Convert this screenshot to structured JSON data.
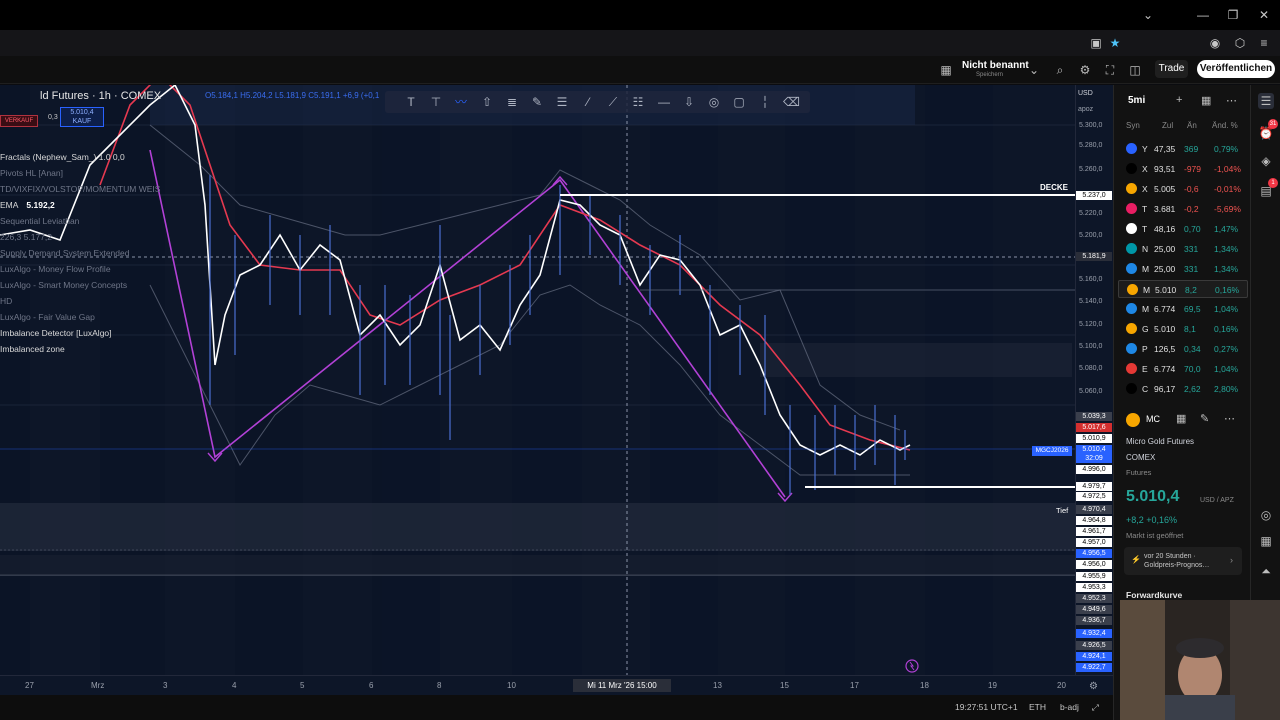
{
  "window": {
    "controls": [
      "⌄",
      "—",
      "❐",
      "✕"
    ]
  },
  "header": {
    "layout_name": "Nicht benannt",
    "layout_sub": "Speichern",
    "trade_label": "Trade",
    "publish_label": "Veröffentlichen"
  },
  "chart": {
    "symbol_title": "ld Futures · 1h · COMEX",
    "ohlc": "O5.184,1 H5.204,2 L5.181,9 C5.191,1 +6,9 (+0,1",
    "sell": {
      "label": "VERKAUF"
    },
    "buy": {
      "price": "5.010,4",
      "label": "KAUF"
    },
    "spread": "0,3",
    "indicators": [
      {
        "name": "Fractals (Nephew_Sam_) 1.0 0,0",
        "value": "",
        "dim": false
      },
      {
        "name": "Pivots HL [Anan]",
        "value": "",
        "dim": true
      },
      {
        "name": "TD/VIXFIX/VOLSTOP/MOMENTUM WEIS",
        "value": "",
        "dim": true
      },
      {
        "name": "EMA",
        "value": "5.192,2",
        "dim": false
      },
      {
        "name": "Sequential Leviathan",
        "value": "",
        "dim": true
      },
      {
        "name": "226,3 5.177,2",
        "value": "",
        "dim": true
      },
      {
        "name": "Supply Demand System Extended",
        "value": "",
        "dim": true
      },
      {
        "name": "LuxAlgo - Money Flow Profile",
        "value": "",
        "dim": true
      },
      {
        "name": "LuxAlgo - Smart Money Concepts",
        "value": "",
        "dim": true
      },
      {
        "name": "HD",
        "value": "",
        "dim": true
      },
      {
        "name": "LuxAlgo - Fair Value Gap",
        "value": "",
        "dim": true
      },
      {
        "name": "Imbalance Detector [LuxAlgo]",
        "value": "",
        "dim": false
      },
      {
        "name": "Imbalanced zone",
        "value": "",
        "dim": false
      }
    ],
    "decke_label": "DECKE",
    "tief_label": "Tief",
    "contract_tag": "MGCJ2026"
  },
  "price_axis": {
    "currency": "USD",
    "unit": "apoz",
    "labels": [
      "5.300,0",
      "5.280,0",
      "5.260,0",
      "5.240,0",
      "5.220,0",
      "5.200,0",
      "5.180,0",
      "5.160,0",
      "5.140,0",
      "5.120,0",
      "5.100,0",
      "5.080,0",
      "5.060,0",
      "5.040,0"
    ],
    "tags": [
      {
        "text": "5.237,0",
        "color": "#ffffff",
        "fg": "#000000"
      },
      {
        "text": "5.181,9",
        "color": "#2a2e39",
        "fg": "#ffffff"
      },
      {
        "text": "5.039,3",
        "color": "#3a3f4c",
        "fg": "#ffffff"
      },
      {
        "text": "5.017,6",
        "color": "#d32f2f",
        "fg": "#ffffff"
      },
      {
        "text": "5.010,9",
        "color": "#ffffff",
        "fg": "#000000"
      },
      {
        "text": "5.010,4",
        "color": "#2962ff",
        "fg": "#ffffff"
      },
      {
        "text": "32:09",
        "color": "#2962ff",
        "fg": "#ffffff"
      },
      {
        "text": "4.996,0",
        "color": "#ffffff",
        "fg": "#000000"
      },
      {
        "text": "4.979,7",
        "color": "#ffffff",
        "fg": "#000000"
      },
      {
        "text": "4.972,5",
        "color": "#ffffff",
        "fg": "#000000"
      },
      {
        "text": "4.970,4",
        "color": "#3a3f4c",
        "fg": "#ffffff"
      },
      {
        "text": "4.964,8",
        "color": "#ffffff",
        "fg": "#000000"
      },
      {
        "text": "4.961,7",
        "color": "#ffffff",
        "fg": "#000000"
      },
      {
        "text": "4.957,0",
        "color": "#ffffff",
        "fg": "#000000"
      },
      {
        "text": "4.956,5",
        "color": "#2962ff",
        "fg": "#ffffff"
      },
      {
        "text": "4.956,0",
        "color": "#ffffff",
        "fg": "#000000"
      },
      {
        "text": "4.955,9",
        "color": "#ffffff",
        "fg": "#000000"
      },
      {
        "text": "4.953,3",
        "color": "#ffffff",
        "fg": "#000000"
      },
      {
        "text": "4.952,3",
        "color": "#3a3f4c",
        "fg": "#ffffff"
      },
      {
        "text": "4.949,6",
        "color": "#3a3f4c",
        "fg": "#ffffff"
      },
      {
        "text": "4.936,7",
        "color": "#3a3f4c",
        "fg": "#ffffff"
      },
      {
        "text": "4.932,4",
        "color": "#2962ff",
        "fg": "#ffffff"
      },
      {
        "text": "4.926,5",
        "color": "#3a3f4c",
        "fg": "#ffffff"
      },
      {
        "text": "4.924,1",
        "color": "#2962ff",
        "fg": "#ffffff"
      },
      {
        "text": "4.922,7",
        "color": "#2962ff",
        "fg": "#ffffff"
      }
    ]
  },
  "time_axis": {
    "labels": [
      "27",
      "Mrz",
      "3",
      "4",
      "5",
      "6",
      "8",
      "10",
      "13",
      "15",
      "17",
      "18",
      "19",
      "20"
    ],
    "cursor_label": "Mi 11 Mrz '26  15:00",
    "cursor_left": "11"
  },
  "status": {
    "time": "19:27:51 UTC+1",
    "session": "ETH",
    "adj": "b-adj"
  },
  "watchlist": {
    "interval": "5mi",
    "columns": [
      "Syn",
      "Zul",
      "Än",
      "Änd. %"
    ],
    "rows": [
      {
        "sym": "Y",
        "last": "47,35",
        "chg": "369",
        "pct": "0,79%",
        "dir": "up",
        "color": "#2962ff"
      },
      {
        "sym": "X",
        "last": "93,51",
        "chg": "-979",
        "pct": "-1,04%",
        "dir": "dn",
        "color": "#000000"
      },
      {
        "sym": "X",
        "last": "5.005",
        "chg": "-0,6",
        "pct": "-0,01%",
        "dir": "dn",
        "color": "#f7a600"
      },
      {
        "sym": "T",
        "last": "3.681",
        "chg": "-0,2",
        "pct": "-5,69%",
        "dir": "dn",
        "color": "#e91e63"
      },
      {
        "sym": "T",
        "last": "48,16",
        "chg": "0,70",
        "pct": "1,47%",
        "dir": "up",
        "color": "#ffffff"
      },
      {
        "sym": "N",
        "last": "25,00",
        "chg": "331",
        "pct": "1,34%",
        "dir": "up",
        "color": "#0097a7"
      },
      {
        "sym": "M",
        "last": "25,00",
        "chg": "331",
        "pct": "1,34%",
        "dir": "up",
        "color": "#1e88e5"
      },
      {
        "sym": "M",
        "last": "5.010",
        "chg": "8,2",
        "pct": "0,16%",
        "dir": "up",
        "color": "#f7a600",
        "selected": true
      },
      {
        "sym": "M",
        "last": "6.774",
        "chg": "69,5",
        "pct": "1,04%",
        "dir": "up",
        "color": "#1e88e5"
      },
      {
        "sym": "G",
        "last": "5.010",
        "chg": "8,1",
        "pct": "0,16%",
        "dir": "up",
        "color": "#f7a600"
      },
      {
        "sym": "P",
        "last": "126,5",
        "chg": "0,34",
        "pct": "0,27%",
        "dir": "up",
        "color": "#1e88e5"
      },
      {
        "sym": "E",
        "last": "6.774",
        "chg": "70,0",
        "pct": "1,04%",
        "dir": "up",
        "color": "#e53935"
      },
      {
        "sym": "C",
        "last": "96,17",
        "chg": "2,62",
        "pct": "2,80%",
        "dir": "up",
        "color": "#000000"
      }
    ]
  },
  "details": {
    "ticker": "MC",
    "name": "Micro Gold Futures",
    "exchange": "COMEX",
    "type": "Futures",
    "price": "5.010,4",
    "unit": "USD / APZ",
    "change": "+8,2  +0,16%",
    "status": "Markt ist geöffnet",
    "news": "vor 20 Stunden · Goldpreis-Prognos…",
    "forward_curve": "Forwardkurve"
  },
  "side_icons": {
    "badges": [
      "31",
      "1"
    ]
  }
}
